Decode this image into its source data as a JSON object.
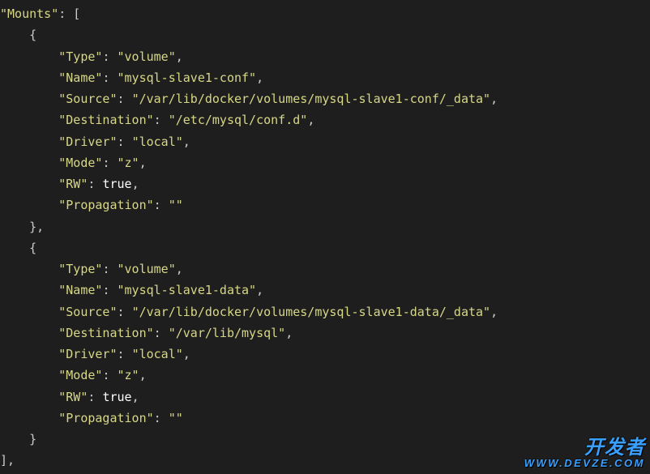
{
  "code": {
    "root_key": "Mounts",
    "mounts": [
      {
        "Type": "volume",
        "Name": "mysql-slave1-conf",
        "Source": "/var/lib/docker/volumes/mysql-slave1-conf/_data",
        "Destination": "/etc/mysql/conf.d",
        "Driver": "local",
        "Mode": "z",
        "RW": true,
        "Propagation": ""
      },
      {
        "Type": "volume",
        "Name": "mysql-slave1-data",
        "Source": "/var/lib/docker/volumes/mysql-slave1-data/_data",
        "Destination": "/var/lib/mysql",
        "Driver": "local",
        "Mode": "z",
        "RW": true,
        "Propagation": ""
      }
    ]
  },
  "watermark": {
    "cn": "开发者",
    "en": "WWW.DEVZE.COM"
  }
}
